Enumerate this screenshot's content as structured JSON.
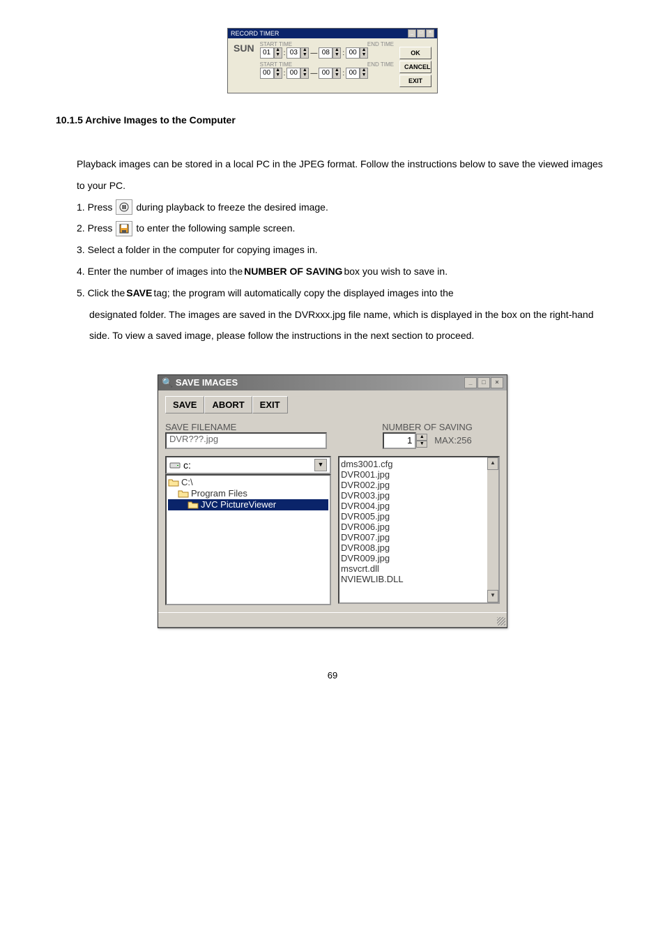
{
  "record_timer": {
    "title": "RECORD TIMER",
    "day": "SUN",
    "rows": [
      {
        "start_label": "START TIME",
        "end_label": "END TIME",
        "s1": "01",
        "s2": "03",
        "e1": "08",
        "e2": "00"
      },
      {
        "start_label": "START TIME",
        "end_label": "END TIME",
        "s1": "00",
        "s2": "00",
        "e1": "00",
        "e2": "00"
      }
    ],
    "buttons": {
      "ok": "OK",
      "cancel": "CANCEL",
      "exit": "EXIT"
    }
  },
  "heading": "10.1.5 Archive Images to the Computer",
  "intro": "Playback images can be stored in a local PC in the JPEG format. Follow the instructions below to save the viewed images to your PC.",
  "steps": {
    "s1a": "1. Press ",
    "s1b": " during playback to freeze the desired image.",
    "s2a": "2. Press ",
    "s2b": " to enter the following sample screen.",
    "s3": "3. Select a folder in the computer for copying images in.",
    "s4a": "4. Enter the number of images into the ",
    "s4b": "NUMBER OF SAVING",
    "s4c": " box you wish to save in.",
    "s5a": "5. Click the ",
    "s5b": "SAVE",
    "s5c": " tag; the program will automatically copy the displayed images into the",
    "s5d": "designated folder. The images are saved in the DVRxxx.jpg file name, which is displayed in the box on the right-hand side. To view a saved image, please follow the instructions in the next section to proceed."
  },
  "save_dialog": {
    "title": "SAVE IMAGES",
    "tabs": {
      "save": "SAVE",
      "abort": "ABORT",
      "exit": "EXIT"
    },
    "filename_label": "SAVE FILENAME",
    "filename_value": "DVR???.jpg",
    "number_label": "NUMBER OF SAVING",
    "number_value": "1",
    "max_label": "MAX:256",
    "drive": "c:",
    "tree": [
      "C:\\",
      "Program Files",
      "JVC PictureViewer"
    ],
    "files": [
      "dms3001.cfg",
      "DVR001.jpg",
      "DVR002.jpg",
      "DVR003.jpg",
      "DVR004.jpg",
      "DVR005.jpg",
      "DVR006.jpg",
      "DVR007.jpg",
      "DVR008.jpg",
      "DVR009.jpg",
      "msvcrt.dll",
      "NVIEWLIB.DLL"
    ]
  },
  "page_number": "69"
}
